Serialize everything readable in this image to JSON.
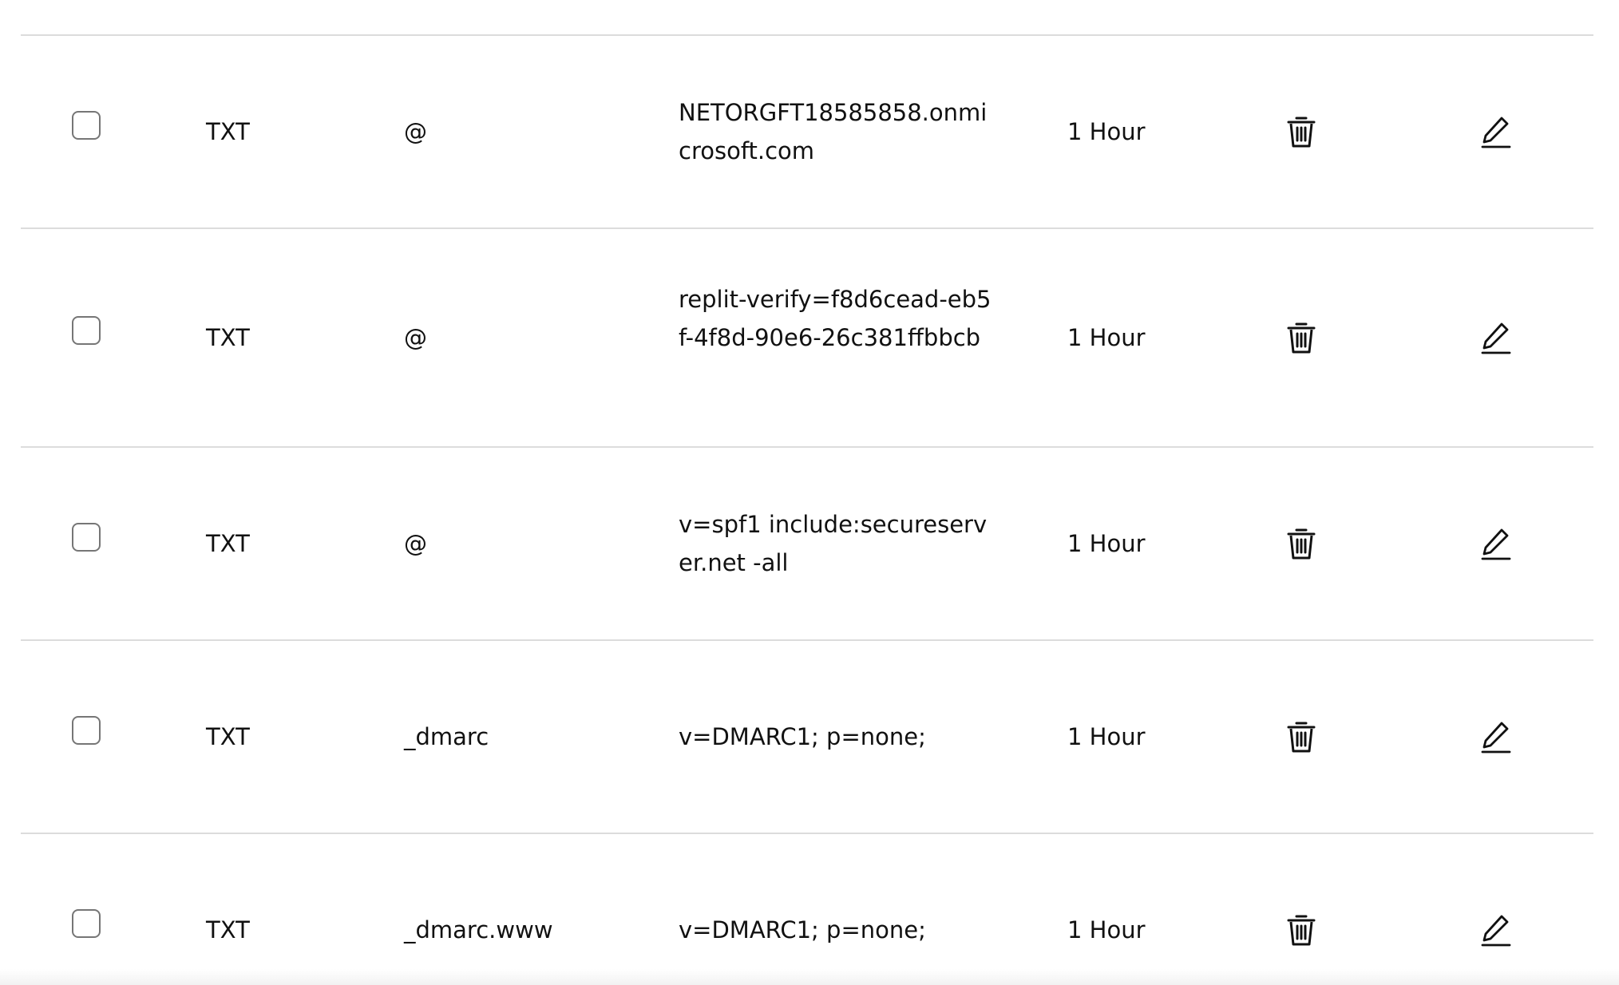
{
  "records": [
    {
      "type": "TXT",
      "name": "@",
      "value": "NETORGFT18585858.onmicrosoft.com",
      "ttl": "1 Hour"
    },
    {
      "type": "TXT",
      "name": "@",
      "value": "replit-verify=f8d6cead-eb5f-4f8d-90e6-26c381ffbbcb",
      "ttl": "1 Hour"
    },
    {
      "type": "TXT",
      "name": "@",
      "value": "v=spf1 include:secureserver.net -all",
      "ttl": "1 Hour"
    },
    {
      "type": "TXT",
      "name": "_dmarc",
      "value": "v=DMARC1; p=none;",
      "ttl": "1 Hour"
    },
    {
      "type": "TXT",
      "name": "_dmarc.www",
      "value": "v=DMARC1; p=none;",
      "ttl": "1 Hour"
    }
  ],
  "icons": {
    "delete": "trash-icon",
    "edit": "pencil-icon",
    "select": "checkbox"
  }
}
